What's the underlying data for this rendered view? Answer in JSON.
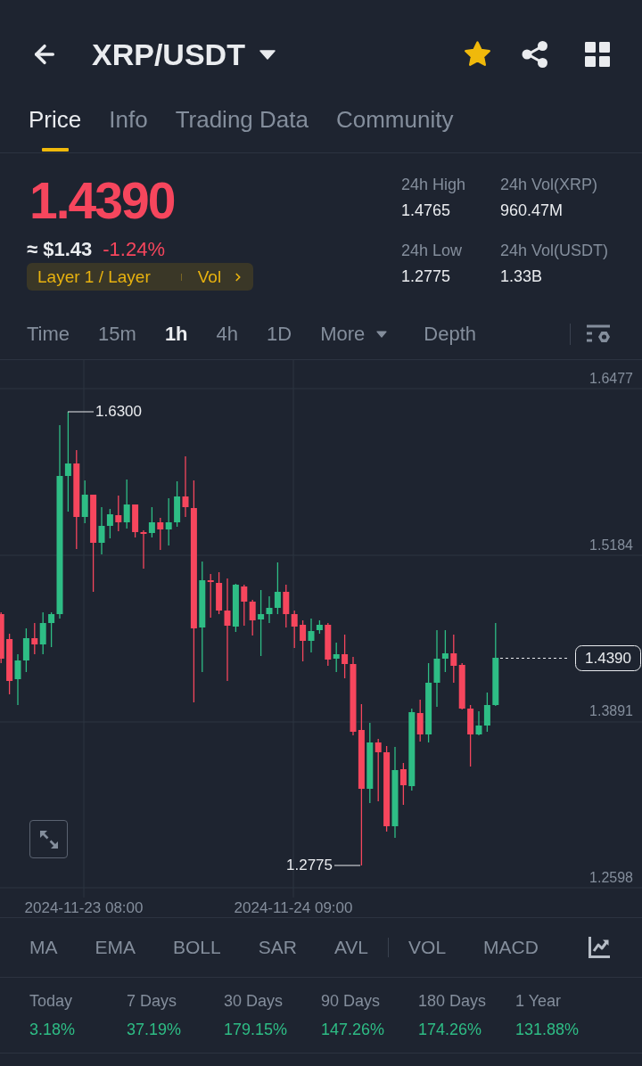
{
  "header": {
    "title": "XRP/USDT",
    "favorite": true
  },
  "tabs": [
    {
      "label": "Price",
      "selected": true
    },
    {
      "label": "Info",
      "selected": false
    },
    {
      "label": "Trading Data",
      "selected": false
    },
    {
      "label": "Community",
      "selected": false
    }
  ],
  "price": {
    "last": "1.4390",
    "approx": "≈ $1.43",
    "change": "-1.24%",
    "falling": true,
    "tag": {
      "category": "Layer 1 / Layer",
      "link": "Vol"
    }
  },
  "stats": [
    {
      "label": "24h High",
      "value": "1.4765"
    },
    {
      "label": "24h Vol(XRP)",
      "value": "960.47M"
    },
    {
      "label": "24h Low",
      "value": "1.2775"
    },
    {
      "label": "24h Vol(USDT)",
      "value": "1.33B"
    }
  ],
  "intervals": [
    {
      "label": "Time",
      "kind": "interval",
      "selected": false
    },
    {
      "label": "15m",
      "kind": "interval",
      "selected": false
    },
    {
      "label": "1h",
      "kind": "interval",
      "selected": true
    },
    {
      "label": "4h",
      "kind": "interval",
      "selected": false
    },
    {
      "label": "1D",
      "kind": "interval",
      "selected": false
    },
    {
      "label": "More",
      "kind": "menu",
      "selected": false
    },
    {
      "label": "Depth",
      "kind": "view",
      "selected": false
    }
  ],
  "chart": {
    "y_axis": [
      "1.6477",
      "1.5184",
      "1.3891",
      "1.2598"
    ],
    "x_axis": [
      "2024-11-23 08:00",
      "2024-11-24 09:00"
    ],
    "high_label": "1.6300",
    "low_label": "1.2775",
    "last_price": "1.4390"
  },
  "indicators": {
    "main": [
      {
        "label": "MA",
        "selected": false
      },
      {
        "label": "EMA",
        "selected": false
      },
      {
        "label": "BOLL",
        "selected": false
      },
      {
        "label": "SAR",
        "selected": false
      },
      {
        "label": "AVL",
        "selected": false
      }
    ],
    "sub": [
      {
        "label": "VOL",
        "selected": false
      },
      {
        "label": "MACD",
        "selected": false
      }
    ]
  },
  "periods": [
    {
      "label": "Today",
      "value": "3.18%",
      "falling": false
    },
    {
      "label": "7 Days",
      "value": "37.19%",
      "falling": false
    },
    {
      "label": "30 Days",
      "value": "179.15%",
      "falling": false
    },
    {
      "label": "90 Days",
      "value": "147.26%",
      "falling": false
    },
    {
      "label": "180 Days",
      "value": "174.26%",
      "falling": false
    },
    {
      "label": "1 Year",
      "value": "131.88%",
      "falling": false
    }
  ]
}
